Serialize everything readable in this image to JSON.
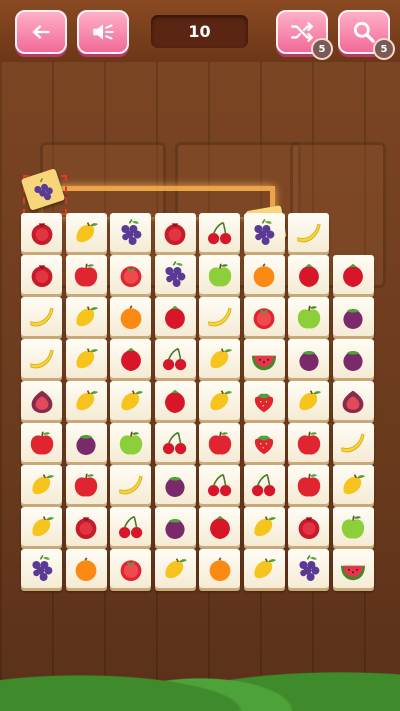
{
  "header": {
    "move_count": "10",
    "shuffle_remaining": "5",
    "hint_remaining": "5"
  },
  "colors": {
    "button": "#f06a97",
    "tile": "#fffdf6",
    "selection": "#e33a2a",
    "connector": "#ffb450"
  },
  "icons": [
    "back-arrow-icon",
    "speaker-icon",
    "shuffle-icon",
    "magnifier-icon"
  ],
  "board": {
    "columns": 8,
    "rows": 9,
    "selected_tile": "grapes",
    "grid": [
      [
        "pomegranate",
        "mango",
        "grapes",
        "pomegranate",
        "cherries",
        "grapes",
        "banana",
        ""
      ],
      [
        "pomegranate",
        "apple",
        "tomato",
        "grapes",
        "green-apple",
        "orange",
        "rambutan",
        "rambutan"
      ],
      [
        "banana",
        "mango",
        "orange",
        "rambutan",
        "banana",
        "tomato",
        "green-apple",
        "mangosteen"
      ],
      [
        "banana",
        "mango",
        "rambutan",
        "cherries",
        "mango",
        "watermelon",
        "mangosteen",
        "mangosteen"
      ],
      [
        "fig",
        "mango",
        "mango",
        "rambutan",
        "mango",
        "strawberry",
        "mango",
        "fig"
      ],
      [
        "apple",
        "mangosteen",
        "green-apple",
        "cherries",
        "apple",
        "strawberry",
        "apple",
        "banana"
      ],
      [
        "mango",
        "apple",
        "banana",
        "mangosteen",
        "cherries",
        "cherries",
        "apple",
        "mango"
      ],
      [
        "mango",
        "pomegranate",
        "cherries",
        "mangosteen",
        "rambutan",
        "mango",
        "pomegranate",
        "green-apple"
      ],
      [
        "grapes",
        "orange",
        "tomato",
        "mango",
        "orange",
        "mango",
        "grapes",
        "watermelon"
      ]
    ]
  }
}
